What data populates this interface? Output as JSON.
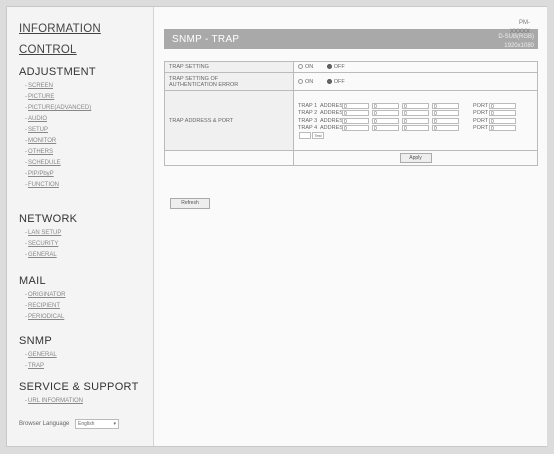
{
  "sidebar": {
    "information": "INFORMATION",
    "control": "CONTROL",
    "adjustment": {
      "title": "ADJUSTMENT",
      "items": [
        "SCREEN",
        "PICTURE",
        "PICTURE(ADVANCED)",
        "AUDIO",
        "SETUP",
        "MONITOR",
        "OTHERS",
        "SCHEDULE",
        "PIP/PbyP",
        "FUNCTION"
      ]
    },
    "network": {
      "title": "NETWORK",
      "items": [
        "LAN SETUP",
        "SECURITY",
        "GENERAL"
      ]
    },
    "mail": {
      "title": "MAIL",
      "items": [
        "ORIGINATOR",
        "RECIPIENT",
        "PERIODICAL"
      ]
    },
    "snmp": {
      "title": "SNMP",
      "items": [
        "GENERAL",
        "TRAP"
      ]
    },
    "service": {
      "title": "SERVICE & SUPPORT",
      "items": [
        "URL INFORMATION"
      ]
    },
    "browser_language_label": "Browser Language",
    "browser_language_value": "English"
  },
  "header": {
    "title": "SNMP - TRAP",
    "model": "PM-XXXXX",
    "input": "D-SUB(RGB)",
    "resolution": "1920x1080"
  },
  "trap_setting": {
    "label": "TRAP SETTING",
    "on_label": "ON",
    "off_label": "OFF",
    "selected": "OFF"
  },
  "auth_error": {
    "label_line1": "TRAP SETTING OF",
    "label_line2": "AUTHENTICATION ERROR",
    "on_label": "ON",
    "off_label": "OFF",
    "selected": "OFF"
  },
  "trap_address": {
    "label": "TRAP ADDRESS & PORT",
    "address_label": "ADDRESS",
    "port_label": "PORT",
    "rows": [
      {
        "name": "TRAP 1",
        "octets": [
          "0",
          "0",
          "0",
          "0"
        ],
        "port": "0"
      },
      {
        "name": "TRAP 2",
        "octets": [
          "0",
          "0",
          "0",
          "0"
        ],
        "port": "0"
      },
      {
        "name": "TRAP 3",
        "octets": [
          "0",
          "0",
          "0",
          "0"
        ],
        "port": "0"
      },
      {
        "name": "TRAP 4",
        "octets": [
          "0",
          "0",
          "0",
          "0"
        ],
        "port": "0"
      }
    ],
    "test_label": "Test"
  },
  "apply_label": "Apply",
  "refresh_label": "Refresh"
}
